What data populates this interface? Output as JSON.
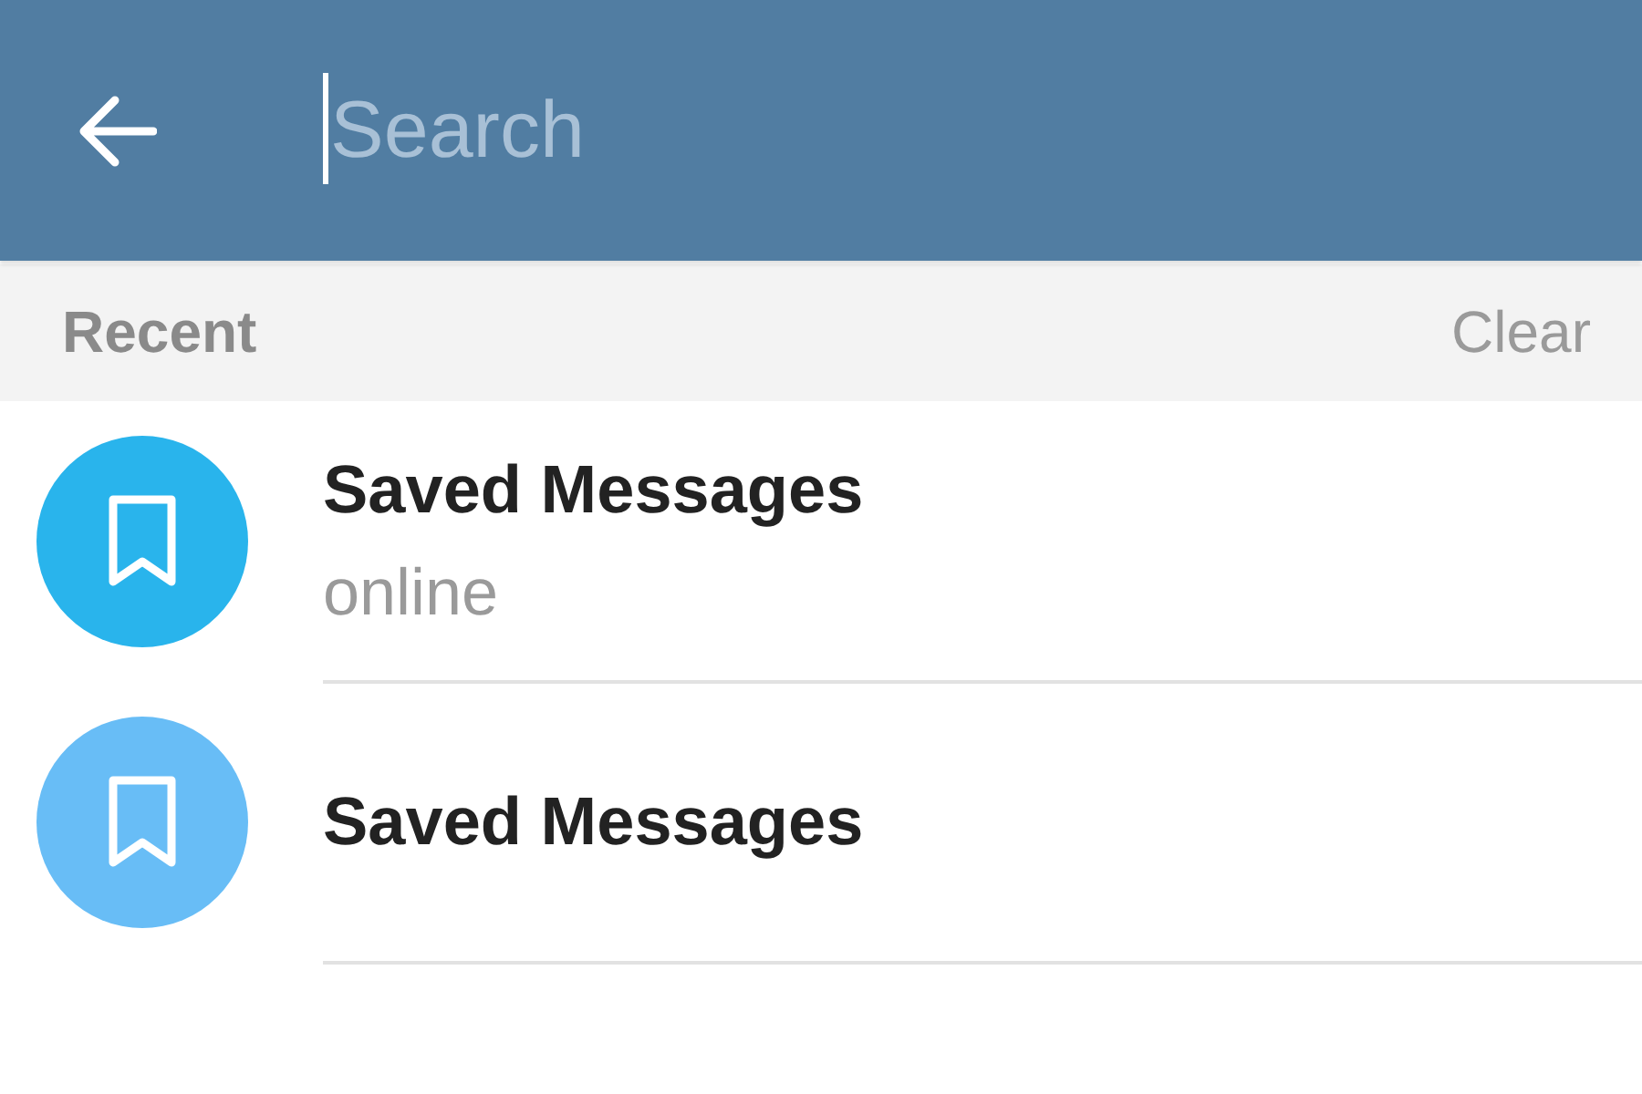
{
  "search": {
    "placeholder": "Search",
    "focused": true
  },
  "recent": {
    "title": "Recent",
    "action": "Clear"
  },
  "chats": [
    {
      "name": "Saved Messages",
      "status": "online",
      "color": "#29b4ec"
    },
    {
      "name": "Saved Messages",
      "color": "#68bdf6"
    }
  ]
}
